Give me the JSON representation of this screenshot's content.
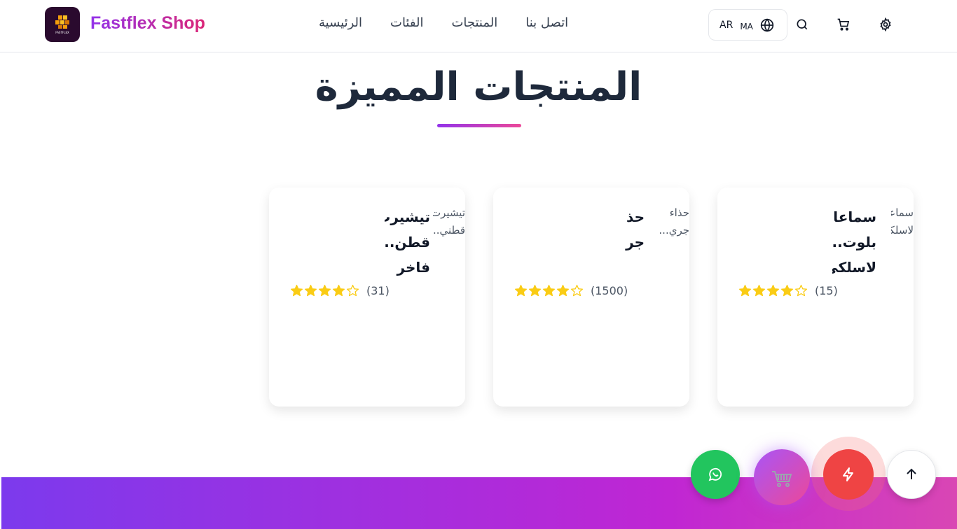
{
  "header": {
    "brand": "Fastflex Shop",
    "logo_text": "FASTFLEX",
    "nav": [
      "الرئيسية",
      "الفئات",
      "المنتجات",
      "اتصل بنا"
    ],
    "lang_code": "AR",
    "region_code": "MA",
    "icons": [
      "globe-icon",
      "search-icon",
      "cart-icon",
      "gear-icon"
    ]
  },
  "featured": {
    "title": "المنتجات المميزة",
    "products": [
      {
        "name_lines": [
          "تيشيرت",
          "قطن...",
          "فاخر"
        ],
        "desc_lines": [
          "تيشيرت",
          "قطني..."
        ],
        "rating": 4,
        "max_rating": 5,
        "review_count": "(31)"
      },
      {
        "name_lines": [
          "حذ",
          "جر"
        ],
        "desc_lines": [
          "حذاء",
          "جري..."
        ],
        "rating": 4,
        "max_rating": 5,
        "review_count": "(1500)"
      },
      {
        "name_lines": [
          "سماعا",
          "بلوت...",
          "لاسلكي"
        ],
        "desc_lines": [
          "سماعات",
          "لاسلكية..."
        ],
        "rating": 4,
        "max_rating": 5,
        "review_count": "(15)"
      }
    ]
  },
  "floating": {
    "icons": [
      "whatsapp-icon",
      "shopping-cart-icon",
      "flash-icon",
      "arrow-up-icon"
    ]
  },
  "colors": {
    "brand_gradient_start": "#9333ea",
    "brand_gradient_end": "#db2777",
    "star": "#facc15",
    "whatsapp": "#22c55e",
    "flash": "#ef4444"
  }
}
